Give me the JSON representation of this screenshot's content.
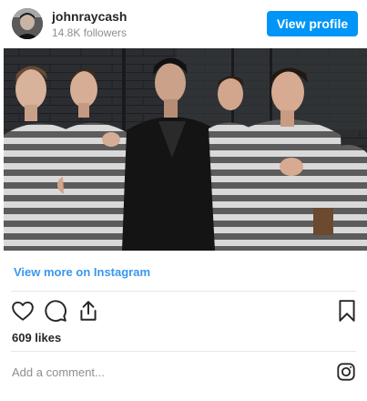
{
  "profile": {
    "username": "johnraycash",
    "followers": "14.8K followers",
    "view_profile_label": "View profile"
  },
  "post": {
    "image_icon": "photo-image",
    "view_more_label": "View more on Instagram",
    "likes": "609 likes"
  },
  "actions": {
    "like_icon": "heart-icon",
    "comment_icon": "comment-icon",
    "share_icon": "share-icon",
    "save_icon": "bookmark-icon"
  },
  "comment": {
    "placeholder": "Add a comment..."
  },
  "footer": {
    "logo_icon": "instagram-logo-icon"
  },
  "colors": {
    "accent": "#0095f6",
    "link": "#3897f0",
    "muted": "#8e8e8e",
    "text": "#262626",
    "divider": "#e6e6e6"
  }
}
